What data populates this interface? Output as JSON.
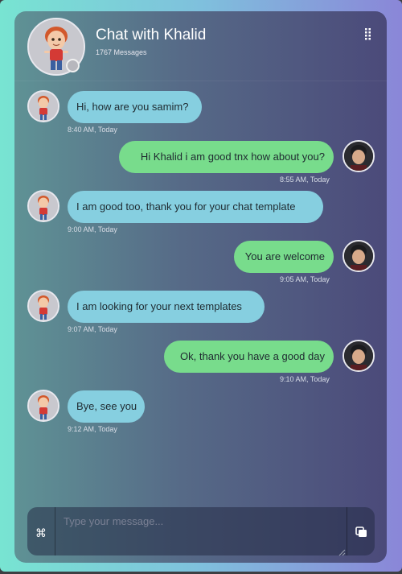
{
  "header": {
    "title": "Chat with Khalid",
    "message_count": "1767 Messages",
    "avatar_icon": "cartoon-boy-avatar",
    "menu_icon": "vertical-dots-icon"
  },
  "messages": [
    {
      "side": "in",
      "text": "Hi, how are you samim?",
      "time": "8:40 AM, Today"
    },
    {
      "side": "out",
      "text": "Hi Khalid i am good tnx how about you?",
      "time": "8:55 AM, Today"
    },
    {
      "side": "in",
      "text": "I am good too, thank you for your chat template",
      "time": "9:00 AM, Today"
    },
    {
      "side": "out",
      "text": "You are welcome",
      "time": "9:05 AM, Today"
    },
    {
      "side": "in",
      "text": "I am looking for your next templates",
      "time": "9:07 AM, Today"
    },
    {
      "side": "out",
      "text": "Ok, thank you have a good day",
      "time": "9:10 AM, Today"
    },
    {
      "side": "in",
      "text": "Bye, see you",
      "time": "9:12 AM, Today"
    }
  ],
  "composer": {
    "placeholder": "Type your message...",
    "command_icon": "⌘",
    "send_icon": "send-icon"
  },
  "colors": {
    "incoming_bubble": "#86cfe0",
    "outgoing_bubble": "#78dc8c"
  }
}
